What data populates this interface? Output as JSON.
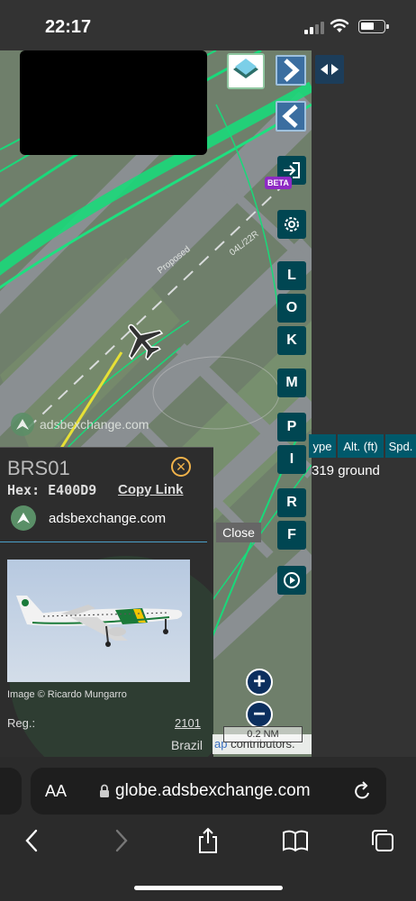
{
  "status_bar": {
    "time": "22:17"
  },
  "map": {
    "runway_labels": [
      "Proposed",
      "04L/22R"
    ],
    "watermark": "adsbexchange.com"
  },
  "controls": {
    "beta_label": "BETA",
    "letters": [
      "L",
      "O",
      "K",
      "M",
      "P",
      "I",
      "R",
      "F"
    ]
  },
  "table": {
    "headers": [
      "ype",
      "Alt. (ft)",
      "Spd."
    ],
    "row": "319 ground"
  },
  "info_panel": {
    "callsign": "BRS01",
    "hex_label": "Hex:",
    "hex_value": "E400D9",
    "copy_link": "Copy Link",
    "brand": "adsbexchange.com",
    "photo_credit": "Image © Ricardo Mungarro",
    "reg_label": "Reg.:",
    "reg_value": "2101",
    "country": "Brazil"
  },
  "close_button": "Close",
  "zoom": {
    "in": "+",
    "out": "−"
  },
  "scale": "0.2 NM",
  "attribution": {
    "link": "ap",
    "text": " contributors."
  },
  "browser": {
    "text_size": "AA",
    "url": "globe.adsbexchange.com"
  }
}
